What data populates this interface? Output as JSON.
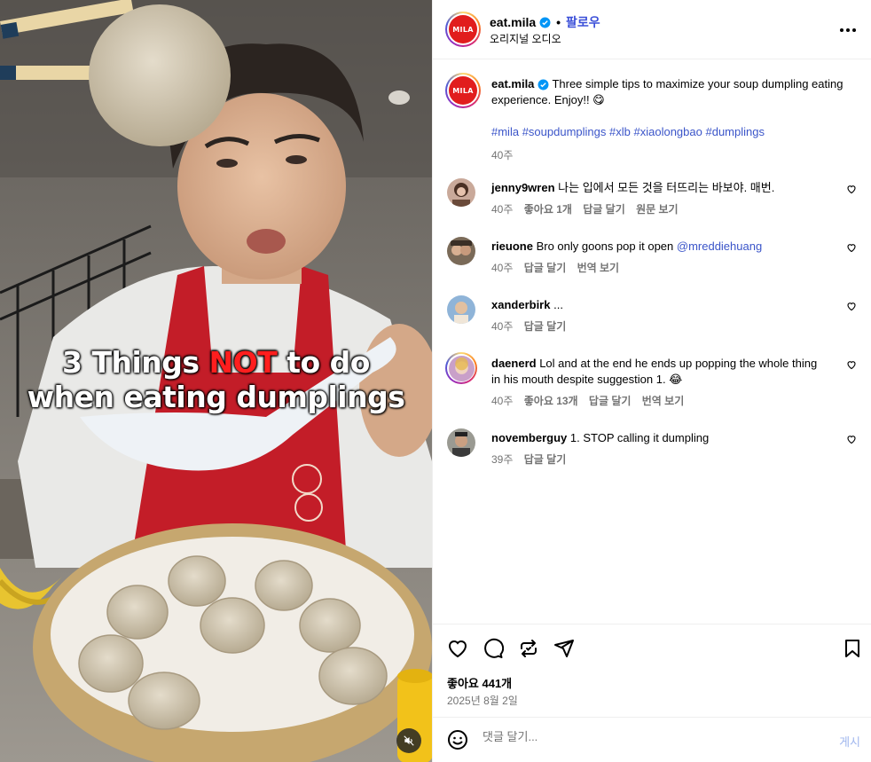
{
  "video": {
    "overlay_line1_a": "3 Things ",
    "overlay_line1_b": "NOT",
    "overlay_line1_c": " to do",
    "overlay_line2": "when eating dumplings",
    "mute_icon": "speaker-muted-icon"
  },
  "header": {
    "username": "eat.mila",
    "follow_label": "팔로우",
    "audio_label": "오리지널 오디오",
    "logo_text": "MILA"
  },
  "caption": {
    "username": "eat.mila",
    "text": "Three simple tips to maximize your soup dumpling eating experience. Enjoy!! 😋",
    "hashtags": [
      "#mila",
      "#soupdumplings",
      "#xlb",
      "#xiaolongbao",
      "#dumplings"
    ],
    "time": "40주"
  },
  "comments": [
    {
      "username": "jenny9wren",
      "text": "나는 입에서 모든 것을 터뜨리는 바보야. 매번.",
      "mention": "",
      "time": "40주",
      "likes": "좋아요 1개",
      "reply": "답글 달기",
      "extra": "원문 보기"
    },
    {
      "username": "rieuone",
      "text": "Bro only goons pop it open ",
      "mention": "@mreddiehuang",
      "time": "40주",
      "likes": "",
      "reply": "답글 달기",
      "extra": "번역 보기"
    },
    {
      "username": "xanderbirk",
      "text": "...",
      "mention": "",
      "time": "40주",
      "likes": "",
      "reply": "답글 달기",
      "extra": ""
    },
    {
      "username": "daenerd",
      "text": "Lol and at the end he ends up popping the whole thing in his mouth despite suggestion 1. 😂",
      "mention": "",
      "time": "40주",
      "likes": "좋아요 13개",
      "reply": "답글 달기",
      "extra": "번역 보기"
    },
    {
      "username": "novemberguy",
      "text": "1. STOP calling it dumpling",
      "mention": "",
      "time": "39주",
      "likes": "",
      "reply": "답글 달기",
      "extra": ""
    }
  ],
  "actions": {
    "likes": "좋아요 441개",
    "date": "2025년 8월 2일"
  },
  "composer": {
    "placeholder": "댓글 달기...",
    "post_label": "게시"
  },
  "colors": {
    "link": "#3b55c9",
    "follow": "#3b4fd8",
    "muted_text": "#737373",
    "post_disabled": "#9fb6ee",
    "overlay_highlight": "#ff1e1e"
  }
}
